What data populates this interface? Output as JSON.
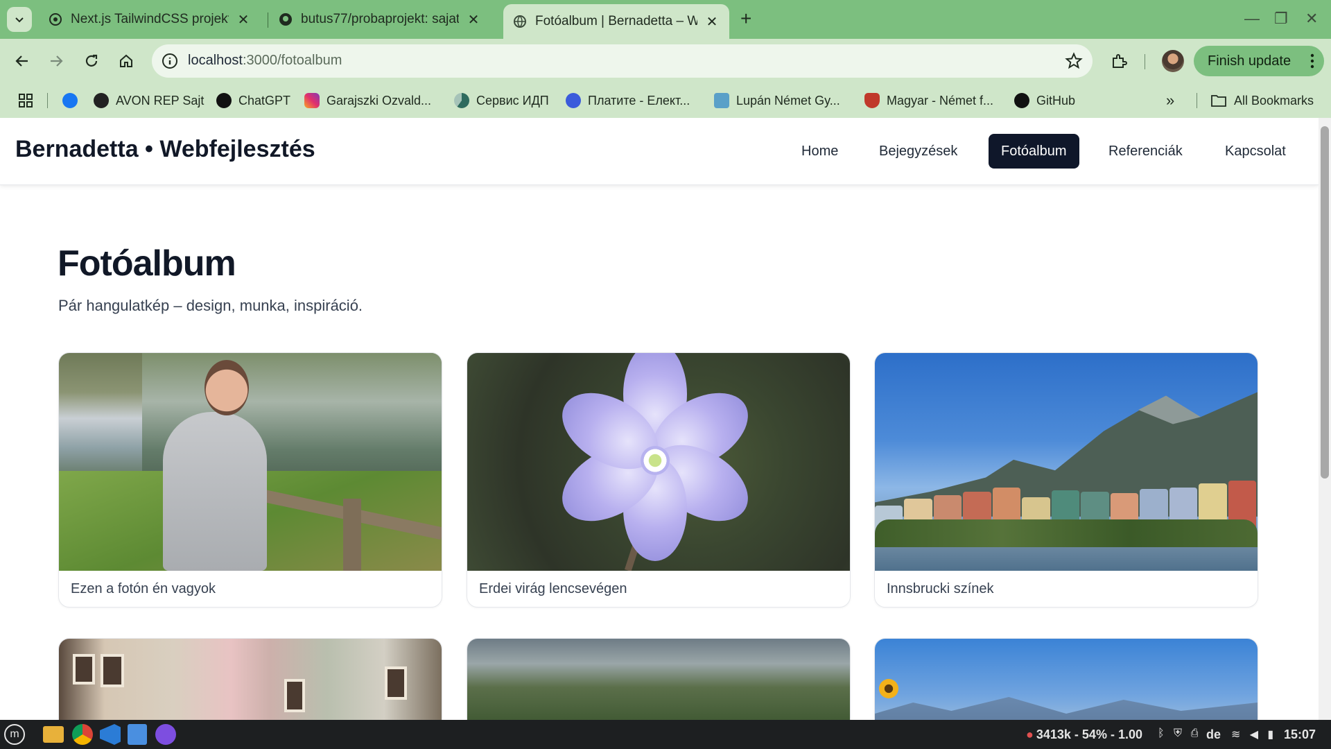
{
  "browser": {
    "tabs": [
      {
        "title": "Next.js TailwindCSS projekt",
        "active": false
      },
      {
        "title": "butus77/probaprojekt: sajat",
        "active": false
      },
      {
        "title": "Fotóalbum | Bernadetta – W",
        "active": true
      }
    ],
    "url": {
      "host": "localhost",
      "path": ":3000/fotoalbum"
    },
    "finish_update_label": "Finish update",
    "bookmarks": [
      {
        "label": "",
        "icon": "facebook-icon",
        "color": "#1877f2"
      },
      {
        "label": "AVON REP Sajt",
        "icon": "globe-icon",
        "color": "#222222"
      },
      {
        "label": "ChatGPT",
        "icon": "chatgpt-icon",
        "color": "#111111"
      },
      {
        "label": "Garajszki Ozvald...",
        "icon": "instagram-icon",
        "color": "#e1306c"
      },
      {
        "label": "Сервис ИДП",
        "icon": "service-icon",
        "color": "#2e6b5e"
      },
      {
        "label": "Платите - Елект...",
        "icon": "pay-icon",
        "color": "#3b5bdb"
      },
      {
        "label": "Lupán Német Gy...",
        "icon": "bird-icon",
        "color": "#5aa0c8"
      },
      {
        "label": "Magyar - Német f...",
        "icon": "shield-icon",
        "color": "#c0392b"
      },
      {
        "label": "GitHub",
        "icon": "github-icon",
        "color": "#111111"
      }
    ],
    "all_bookmarks_label": "All Bookmarks"
  },
  "site": {
    "brand": "Bernadetta • Webfejlesztés",
    "nav": [
      "Home",
      "Bejegyzések",
      "Fotóalbum",
      "Referenciák",
      "Kapcsolat"
    ],
    "active_nav": "Fotóalbum"
  },
  "main": {
    "title": "Fotóalbum",
    "subtitle": "Pár hangulatkép – design, munka, inspiráció.",
    "photos": [
      {
        "caption": "Ezen a fotón én vagyok"
      },
      {
        "caption": "Erdei virág lencsevégen"
      },
      {
        "caption": "Innsbrucki színek"
      },
      {
        "caption": ""
      },
      {
        "caption": ""
      },
      {
        "caption": ""
      }
    ]
  },
  "taskbar": {
    "status": "3413k - 54% - 1.00",
    "lang": "de",
    "time": "15:07"
  },
  "colors": {
    "chrome_green": "#7cbf7f",
    "toolbar_green": "#cfe6c9",
    "nav_active_bg": "#0f172a",
    "text_dark": "#111827"
  }
}
